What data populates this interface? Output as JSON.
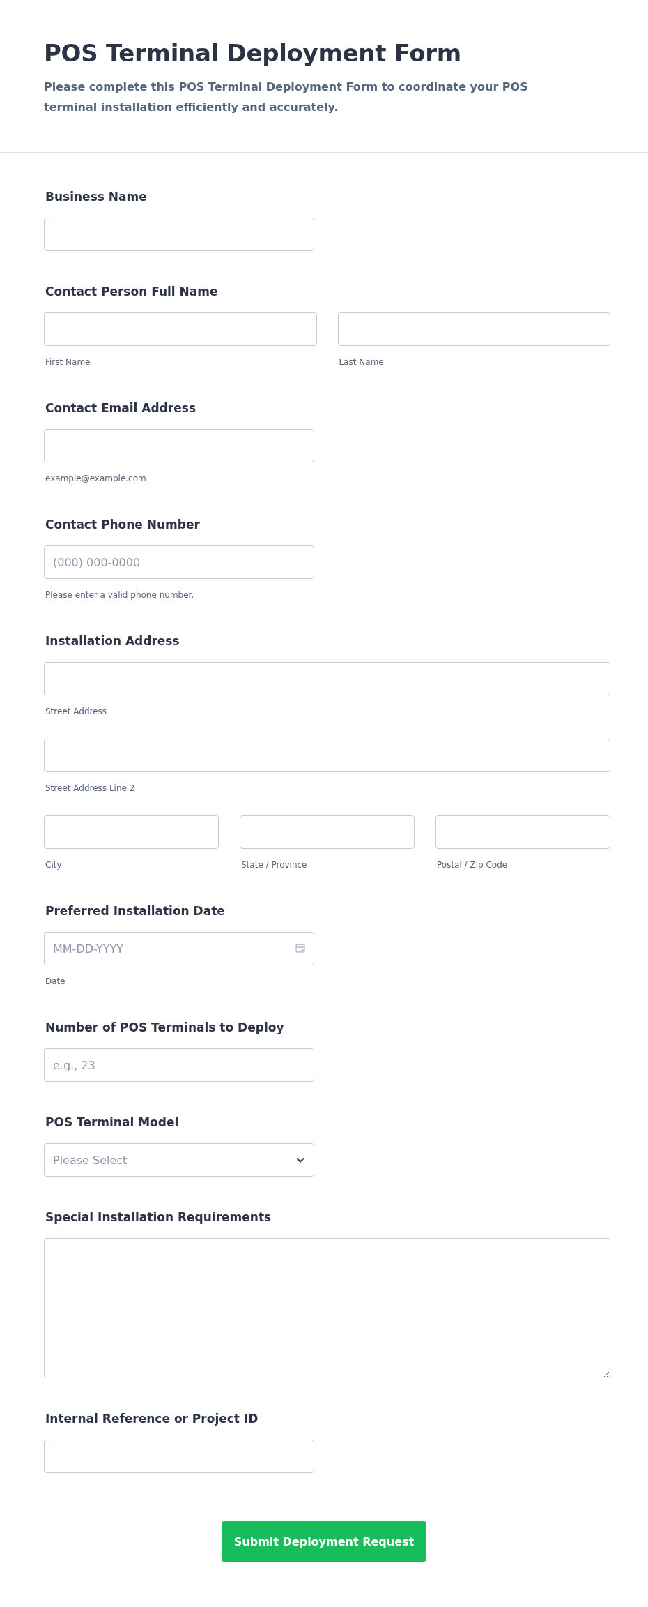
{
  "header": {
    "title": "POS Terminal Deployment Form",
    "description": "Please complete this POS Terminal Deployment Form to coordinate your POS terminal installation efficiently and accurately."
  },
  "fields": [
    {
      "kind": "text",
      "label": "Business Name"
    },
    {
      "kind": "name",
      "label": "Contact Person Full Name",
      "parts": [
        {
          "sublabel": "First Name"
        },
        {
          "sublabel": "Last Name"
        }
      ]
    },
    {
      "kind": "text",
      "label": "Contact Email Address",
      "sublabel": "example@example.com"
    },
    {
      "kind": "text",
      "label": "Contact Phone Number",
      "placeholder": "(000) 000-0000",
      "sublabel": "Please enter a valid phone number."
    },
    {
      "kind": "address",
      "label": "Installation Address",
      "lines": [
        {
          "sublabel": "Street Address"
        },
        {
          "sublabel": "Street Address Line 2"
        }
      ],
      "parts": [
        {
          "sublabel": "City"
        },
        {
          "sublabel": "State / Province"
        },
        {
          "sublabel": "Postal / Zip Code"
        }
      ]
    },
    {
      "kind": "date",
      "label": "Preferred Installation Date",
      "placeholder": "MM-DD-YYYY",
      "sublabel": "Date"
    },
    {
      "kind": "text",
      "label": "Number of POS Terminals to Deploy",
      "placeholder": "e.g., 23"
    },
    {
      "kind": "select",
      "label": "POS Terminal Model",
      "placeholder": "Please Select"
    },
    {
      "kind": "textarea",
      "label": "Special Installation Requirements"
    },
    {
      "kind": "text",
      "label": "Internal Reference or Project ID"
    }
  ],
  "submit": {
    "label": "Submit Deployment Request"
  }
}
